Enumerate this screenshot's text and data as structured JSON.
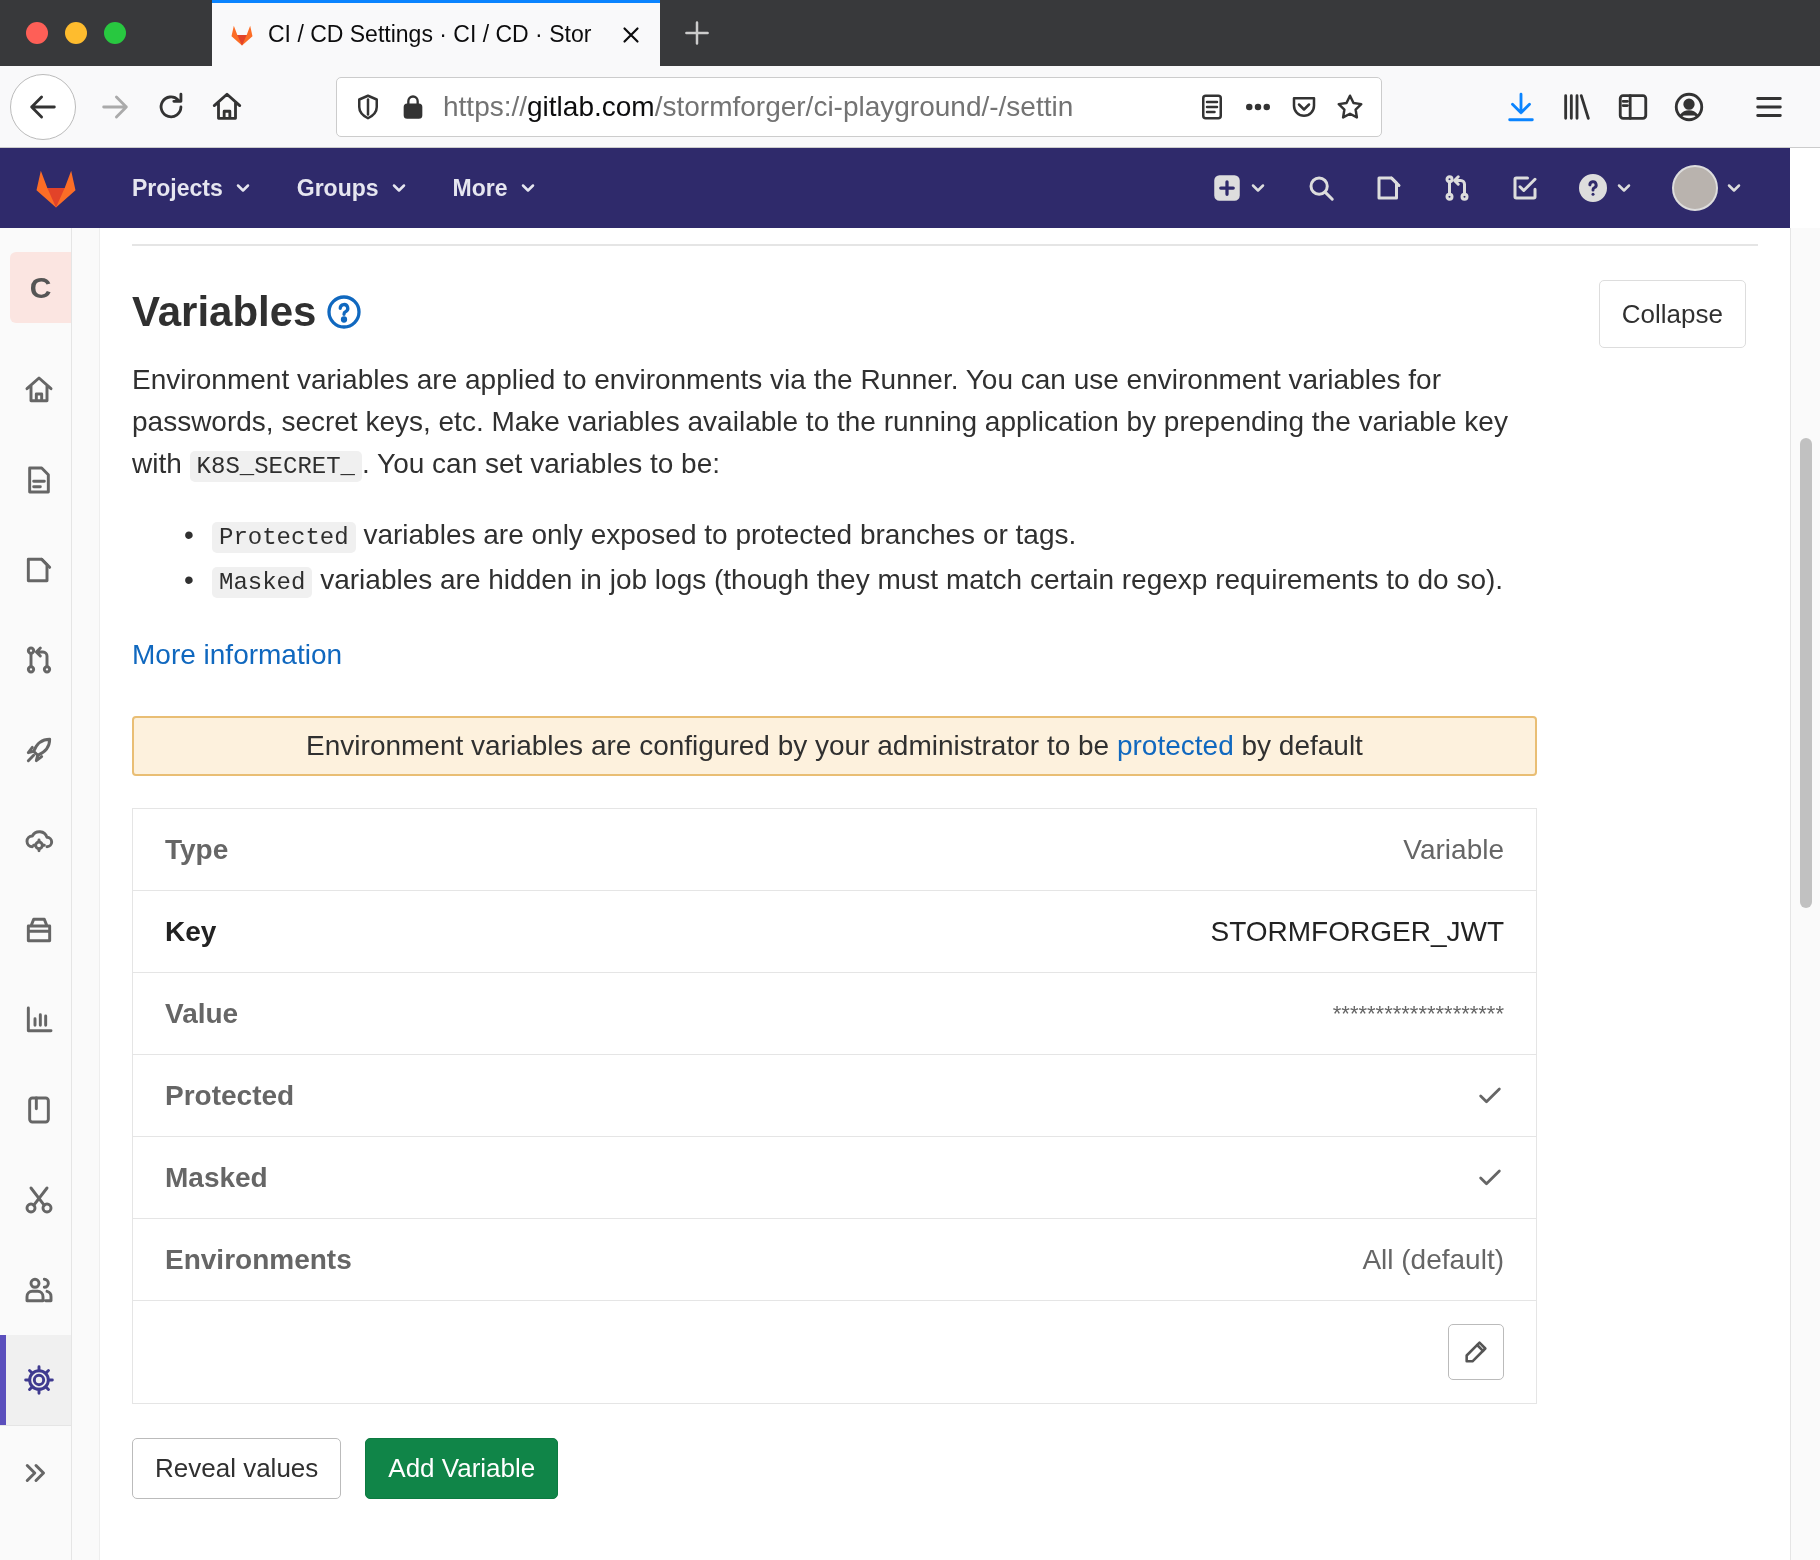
{
  "browser": {
    "tabs": [
      {
        "title": "CI / CD Settings · CI / CD · Stor",
        "selected": true
      }
    ],
    "url": {
      "scheme": "https://",
      "host": "gitlab.com",
      "path": "/stormforger/ci-playground/-/settin"
    }
  },
  "navbar": {
    "menus": [
      {
        "label": "Projects"
      },
      {
        "label": "Groups"
      },
      {
        "label": "More"
      }
    ]
  },
  "sidebar": {
    "project_letter": "C",
    "items": [
      {
        "kind": "home",
        "selected": false
      },
      {
        "kind": "repository",
        "selected": false
      },
      {
        "kind": "issues",
        "selected": false
      },
      {
        "kind": "merge_requests",
        "selected": false
      },
      {
        "kind": "ci_cd",
        "selected": false
      },
      {
        "kind": "operations",
        "selected": false
      },
      {
        "kind": "packages",
        "selected": false
      },
      {
        "kind": "analytics",
        "selected": false
      },
      {
        "kind": "wiki",
        "selected": false
      },
      {
        "kind": "snippets",
        "selected": false
      },
      {
        "kind": "members",
        "selected": false
      },
      {
        "kind": "settings",
        "selected": true
      }
    ]
  },
  "section": {
    "title": "Variables",
    "collapse_button": "Collapse",
    "intro": [
      {
        "kind": "text",
        "text": "Environment variables are applied to environments via the Runner. You can use environment variables for passwords, secret keys, etc. Make variables available to the running application by prepending the variable key with "
      },
      {
        "kind": "code",
        "text": "K8S_SECRET_"
      },
      {
        "kind": "text",
        "text": ". You can set variables to be:"
      }
    ],
    "bullets": [
      {
        "marker": "•",
        "parts": [
          {
            "kind": "code",
            "text": "Protected"
          },
          {
            "kind": "text",
            "text": " variables are only exposed to protected branches or tags."
          }
        ]
      },
      {
        "marker": "•",
        "parts": [
          {
            "kind": "code",
            "text": "Masked"
          },
          {
            "kind": "text",
            "text": " variables are hidden in job logs (though they must match certain regexp requirements to do so)."
          }
        ]
      }
    ],
    "more_info_link": "More information",
    "alert": [
      {
        "kind": "text",
        "text": "Environment variables are configured by your administrator to be "
      },
      {
        "kind": "link",
        "text": "protected"
      },
      {
        "kind": "text",
        "text": " by default"
      }
    ],
    "variable_rows": [
      {
        "label": "Type",
        "kind": "text",
        "value": "Variable",
        "emphasized": false
      },
      {
        "label": "Key",
        "kind": "text",
        "value": "STORMFORGER_JWT",
        "emphasized": true
      },
      {
        "label": "Value",
        "kind": "masked",
        "value": "********************",
        "emphasized": false
      },
      {
        "label": "Protected",
        "kind": "check",
        "checked": true,
        "emphasized": false
      },
      {
        "label": "Masked",
        "kind": "check",
        "checked": true,
        "emphasized": false
      },
      {
        "label": "Environments",
        "kind": "text",
        "value": "All (default)",
        "emphasized": false
      }
    ],
    "buttons": [
      {
        "label": "Reveal values",
        "kind": "secondary"
      },
      {
        "label": "Add Variable",
        "kind": "primary"
      }
    ]
  }
}
